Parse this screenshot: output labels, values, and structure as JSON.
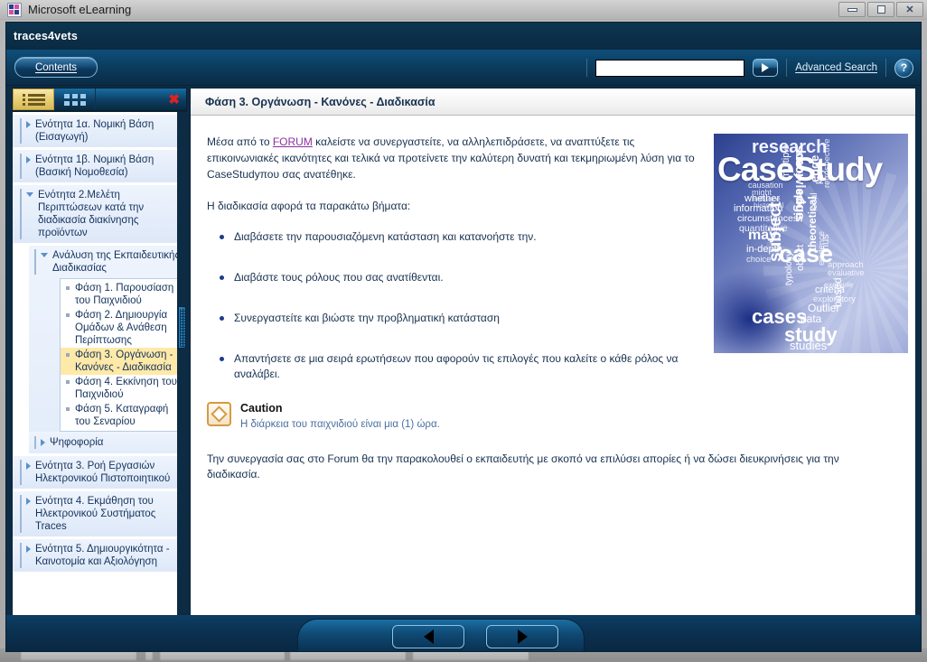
{
  "window": {
    "title": "Microsoft eLearning",
    "logo_icon": "microsoft-squares-icon",
    "minimize_label": "Minimize",
    "maximize_label": "Maximize",
    "close_label": "Close"
  },
  "brand": {
    "name": "traces4vets"
  },
  "toolbar": {
    "contents_label": "Contents",
    "search_value": "",
    "search_placeholder": "",
    "search_go_icon": "play-arrow-icon",
    "advanced_search_label": "Advanced Search",
    "help_label": "?"
  },
  "sidebar": {
    "tabs": [
      {
        "icon": "list-view-icon",
        "active": true
      },
      {
        "icon": "grid-view-icon",
        "active": false
      }
    ],
    "close_label": "✖",
    "tree": [
      {
        "label": "Ενότητα 1α. Νομική Βάση (Εισαγωγή)",
        "state": "collapsed"
      },
      {
        "label": "Ενότητα 1β. Νομική Βάση (Βασική Νομοθεσία)",
        "state": "collapsed"
      },
      {
        "label": "Ενότητα 2.Μελέτη Περιπτώσεων κατά την διαδικασία διακίνησης προϊόντων",
        "state": "expanded"
      }
    ],
    "subtree": {
      "label": "Ανάλυση της Εκπαιδευτικής Διαδικασίας",
      "state": "expanded"
    },
    "leaves": [
      {
        "label": "Φάση 1. Παρουσίαση του Παιχνιδιού",
        "selected": false
      },
      {
        "label": "Φάση 2. Δημιουργία Ομάδων & Ανάθεση Περίπτωσης",
        "selected": false
      },
      {
        "label": "Φάση 3. Οργάνωση - Κανόνες - Διαδικασία",
        "selected": true
      },
      {
        "label": "Φάση 4. Εκκίνηση του Παιχνιδιού",
        "selected": false
      },
      {
        "label": "Φάση 5. Καταγραφή του Σεναρίου",
        "selected": false
      }
    ],
    "vote": {
      "label": "Ψηφοφορία",
      "state": "collapsed"
    },
    "tree_bottom": [
      {
        "label": "Ενότητα 3. Ροή Εργασιών Ηλεκτρονικού Πιστοποιητικού",
        "state": "collapsed"
      },
      {
        "label": "Ενότητα 4. Εκμάθηση του Ηλεκτρονικού Συστήματος Traces",
        "state": "collapsed"
      },
      {
        "label": "Ενότητα 5. Δημιουργικότητα - Καινοτομία και Αξιολόγηση",
        "state": "collapsed"
      }
    ]
  },
  "content": {
    "title": "Φάση 3. Οργάνωση - Κανόνες - Διαδικασία",
    "paragraph1_before": "Μέσα από το ",
    "paragraph1_link": "FORUM",
    "paragraph1_after": " καλείστε να συνεργαστείτε, να αλληλεπιδράσετε, να αναπτύξετε τις επικοινωνιακές ικανότητες και τελικά να προτείνετε την καλύτερη δυνατή και τεκμηριωμένη λύση για το CaseStudyπου σας ανατέθηκε.",
    "paragraph2": "Η διαδικασία αφορά τα  παρακάτω βήματα:",
    "bullets": [
      "Διαβάσετε την παρουσιαζόμενη κατάσταση και κατανοήστε την.",
      "Διαβάστε τους ρόλους που σας ανατίθενται.",
      "Συνεργαστείτε και βιώστε την προβληματική κατάσταση",
      "Απαντήσετε σε μια σειρά ερωτήσεων που αφορούν τις επιλογές που καλείτε ο κάθε ρόλος να αναλάβει."
    ],
    "caution": {
      "icon": "caution-diamond-icon",
      "title": "Caution",
      "body": "Η διάρκεια του παιχνιδιού είναι μια (1) ώρα."
    },
    "paragraph3": "Την συνεργασία σας στο Forum θα την παρακολουθεί ο εκπαιδευτής με σκοπό να επιλύσει απορίες ή να δώσει διευκρινήσεις για την διαδικασία.",
    "image": {
      "name": "case-study-word-cloud",
      "words": {
        "research": "research",
        "main": "CaseStudy",
        "case": "case",
        "cases": "cases",
        "study": "study",
        "studies": "studies",
        "subject": "subject",
        "knowledge": "knowledge",
        "may": "may",
        "in_depth": "in-depth",
        "circumstances": "circumstances",
        "information": "information",
        "whether": "whether",
        "quantitative": "quantitative",
        "focus": "focus",
        "edge": "edge",
        "single": "single",
        "multiple": "multiple",
        "theoretical": "theoretical",
        "object": "object",
        "typology": "typology",
        "evidence": "evidence",
        "based": "based",
        "criteria": "criteria",
        "exploratory": "exploratory",
        "outlier": "Outlier",
        "data": "data",
        "approach": "approach",
        "evaluative": "evaluative",
        "causation": "causation",
        "might": "might",
        "instance": "instance",
        "historical": "historical",
        "choice": "choice",
        "local": "local",
        "retrospective": "retrospective",
        "key": "key",
        "example": "example",
        "thus": "thus"
      }
    }
  },
  "bottom_nav": {
    "prev_icon": "arrow-left-icon",
    "next_icon": "arrow-right-icon"
  },
  "colors": {
    "app_dark": "#0d2c44",
    "toolbar_blue": "#0e4f7a",
    "selection_yellow": "#ffe9a8",
    "link_purple": "#8b2fa0",
    "text_navy": "#17314f",
    "caution_orange": "#d79a40"
  }
}
